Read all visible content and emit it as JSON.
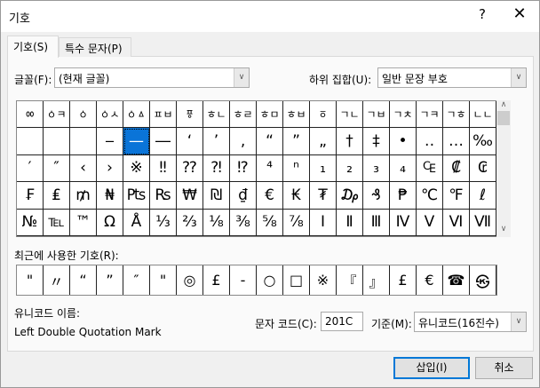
{
  "window": {
    "title": "기호",
    "help": "?",
    "close": "✕"
  },
  "tabs": [
    {
      "label": "기호(S)"
    },
    {
      "label": "특수 문자(P)"
    }
  ],
  "font": {
    "label": "글꼴(F):",
    "value": "(현재 글꼴)"
  },
  "subset": {
    "label": "하위 집합(U):",
    "value": "일반 문장 부호"
  },
  "grid": {
    "selected_index": 22,
    "cells": [
      "ㆀ",
      "ㆁㅋ",
      "ㆁ",
      "ㆁㅅ",
      "ㆁㅿ",
      "ㅍㅂ",
      "ㆄ",
      "ㅎㄴ",
      "ㅎㄹ",
      "ㅎㅁ",
      "ㅎㅂ",
      "ㆆ",
      "ㄱㄴ",
      "ㄱㅂ",
      "ㄱㅊ",
      "ㄱㅋ",
      "ㄱㅎ",
      "ㄴㄴ",
      "",
      "",
      "",
      "‒",
      "—",
      "―",
      "‘",
      "’",
      "‚",
      "“",
      "”",
      "„",
      "†",
      "‡",
      "•",
      "‥",
      "…",
      "‰",
      "′",
      "″",
      "‹",
      "›",
      "※",
      "‼",
      "⁇",
      "⁈",
      "⁉",
      "⁴",
      "ⁿ",
      "₁",
      "₂",
      "₃",
      "₄",
      "₠",
      "₡",
      "₢",
      "₣",
      "₤",
      "₥",
      "₦",
      "₧",
      "₨",
      "₩",
      "₪",
      "₫",
      "€",
      "₭",
      "₮",
      "₯",
      "₰",
      "₱",
      "℃",
      "℉",
      "ℓ",
      "№",
      "℡",
      "™",
      "Ω",
      "Å",
      "⅓",
      "⅔",
      "⅛",
      "⅜",
      "⅝",
      "⅞",
      "Ⅰ",
      "Ⅱ",
      "Ⅲ",
      "Ⅳ",
      "Ⅴ",
      "Ⅵ",
      "Ⅶ"
    ]
  },
  "recent": {
    "label": "최근에 사용한 기호(R):",
    "cells": [
      "\"",
      "〃",
      "“",
      "”",
      "″",
      "\"",
      "◎",
      "£",
      "-",
      "○",
      "□",
      "※",
      "『",
      "』",
      "£",
      "€",
      "☎",
      "㉿"
    ]
  },
  "unicode_name": {
    "label": "유니코드 이름:",
    "value": "Left Double Quotation Mark"
  },
  "char_code": {
    "label": "문자 코드(C):",
    "value": "201C"
  },
  "basis": {
    "label": "기준(M):",
    "value": "유니코드(16진수)"
  },
  "buttons": {
    "insert": "삽입(I)",
    "cancel": "취소"
  },
  "colors": {
    "selection": "#0a74d8",
    "accent": "#0078d7"
  }
}
